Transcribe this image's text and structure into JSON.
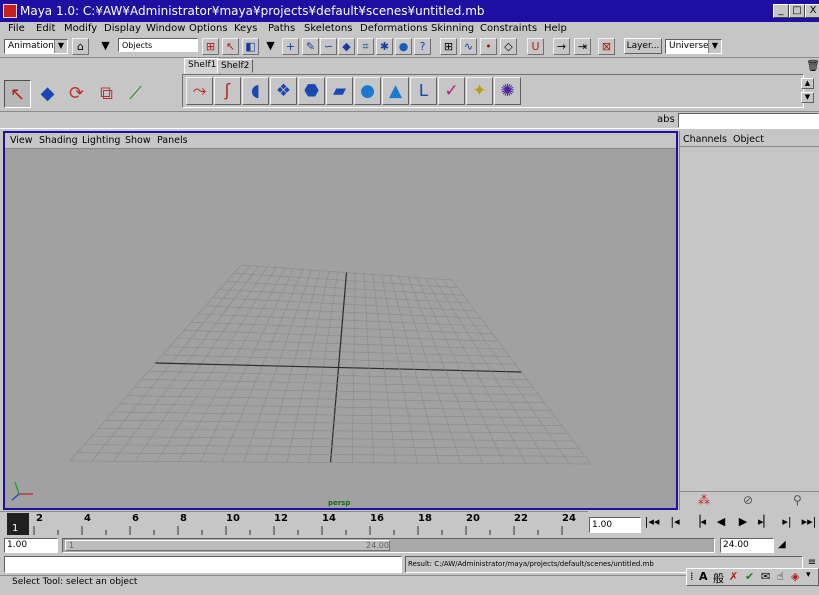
{
  "window": {
    "title": "Maya 1.0: C:¥AW¥Administrator¥maya¥projects¥default¥scenes¥untitled.mb",
    "minimize_icon": "minimize-icon",
    "maximize_icon": "maximize-icon",
    "close_label": "X"
  },
  "menubar": [
    "File",
    "Edit",
    "Modify",
    "Display",
    "Window",
    "Options",
    "Keys",
    "Paths",
    "Skeletons",
    "Deformations",
    "Skinning",
    "Constraints",
    "Help"
  ],
  "statusline": {
    "menu_set": "Animation",
    "selection_mode": "Objects",
    "layer_button": "Layer...",
    "layer_value": "Universe"
  },
  "shelf": {
    "tabs": [
      "Shelf1",
      "Shelf2"
    ],
    "active_tab": "Shelf1"
  },
  "numeric_input_label": "abs",
  "viewport": {
    "menu": [
      "View",
      "Shading",
      "Lighting",
      "Show",
      "Panels"
    ],
    "camera_label": "persp"
  },
  "channel_box": {
    "menu": [
      "Channels",
      "Object"
    ]
  },
  "timeline": {
    "ticks": [
      "2",
      "4",
      "6",
      "8",
      "10",
      "12",
      "14",
      "16",
      "18",
      "20",
      "22",
      "24"
    ],
    "current_frame": "1",
    "current_time_field": "1.00"
  },
  "range": {
    "start": "1.00",
    "slider_start": "1",
    "slider_end": "24.00",
    "end": "24.00"
  },
  "command": {
    "result": "Result: C:/AW/Administrator/maya/projects/default/scenes/untitled.mb"
  },
  "helpline": "Select Tool: select an object",
  "colors": {
    "title_bg": "#1c0fa2",
    "viewport_bg": "#a1a1a1",
    "grid_line": "#8b8b8b",
    "axis_line": "#2a2a2a",
    "camera_label": "#1a6a1a",
    "timeline_marker": "#202020"
  }
}
